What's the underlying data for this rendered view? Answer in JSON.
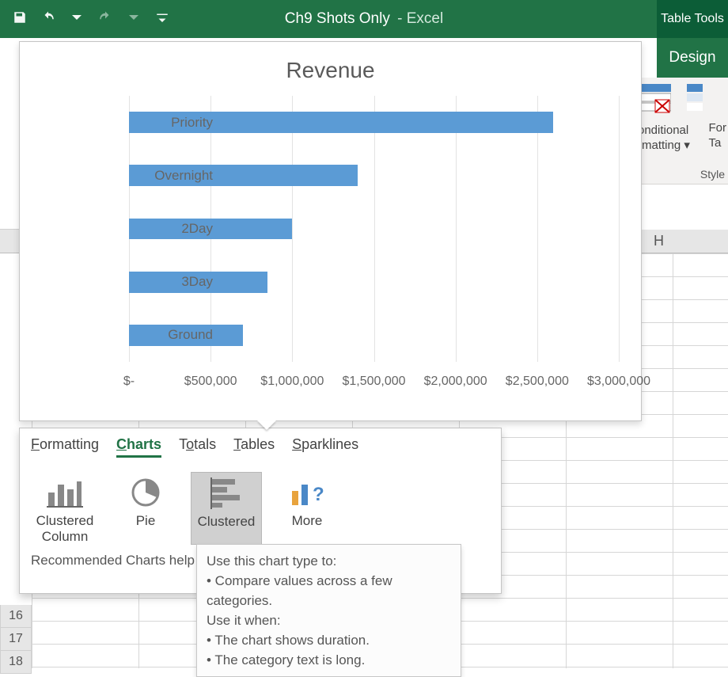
{
  "title": {
    "document": "Ch9 Shots Only",
    "separator": "  -  ",
    "app": "Excel"
  },
  "tab_tools": {
    "label": "Table Tools",
    "sublabel": "Design"
  },
  "ribbon_peek": {
    "cond_fmt_top": "onditional",
    "cond_fmt_bottom": "rmatting ▾",
    "fmt_top": "For",
    "fmt_bottom": "Ta",
    "styles": "Style"
  },
  "grid": {
    "col_letter": "H",
    "row_numbers": [
      "16",
      "17",
      "18"
    ]
  },
  "chart_data": {
    "type": "bar",
    "title": "Revenue",
    "categories": [
      "Priority",
      "Overnight",
      "2Day",
      "3Day",
      "Ground"
    ],
    "values": [
      2600000,
      1400000,
      1000000,
      850000,
      700000
    ],
    "xlabel": "",
    "ylabel": "",
    "xlim": [
      0,
      3000000
    ],
    "xticks": [
      0,
      500000,
      1000000,
      1500000,
      2000000,
      2500000,
      3000000
    ],
    "xtick_labels": [
      "$-",
      "$500,000",
      "$1,000,000",
      "$1,500,000",
      "$2,000,000",
      "$2,500,000",
      "$3,000,000"
    ]
  },
  "qa_panel": {
    "tabs": [
      "Formatting",
      "Charts",
      "Totals",
      "Tables",
      "Sparklines"
    ],
    "selected_tab": "Charts",
    "options": [
      {
        "label": "Clustered Column"
      },
      {
        "label": "Pie"
      },
      {
        "label": "Clustered"
      },
      {
        "label": "More"
      }
    ],
    "selected_option": 2,
    "help_text": "Recommended Charts help you"
  },
  "tooltip": {
    "line1": "Use this chart type to:",
    "line2": "• Compare values across a few categories.",
    "line3": "Use it when:",
    "line4": "• The chart shows duration.",
    "line5": "• The category text is long."
  }
}
